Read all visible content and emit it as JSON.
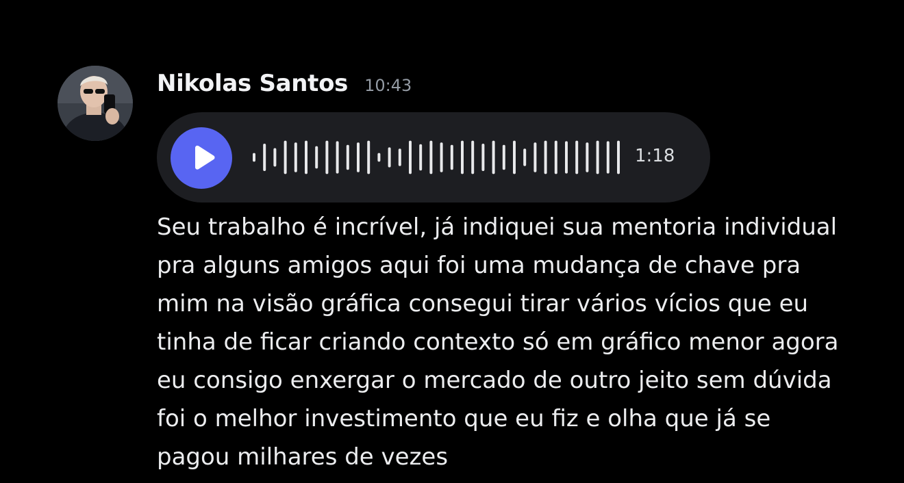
{
  "message": {
    "author": "Nikolas Santos",
    "timestamp": "10:43",
    "voice_message": {
      "duration": "1:18",
      "accent_color": "#5865f2"
    },
    "content": "Seu trabalho é incrível, já indiquei sua mentoria individual pra alguns amigos aqui foi uma mudança de chave pra mim na visão gráfica consegui tirar vários vícios que eu tinha de ficar criando contexto só em gráfico menor agora eu consigo enxergar o mercado de outro jeito sem dúvida foi o melhor investimento que eu fiz e olha que já se pagou milhares de vezes"
  }
}
